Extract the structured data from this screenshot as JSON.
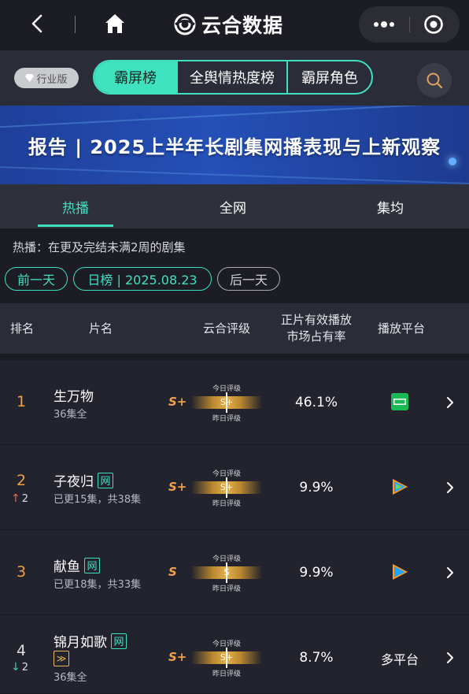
{
  "app": {
    "brand": "云合数据"
  },
  "category": {
    "edition_label": "行业版",
    "segments": [
      {
        "label": "霸屏榜",
        "active": true
      },
      {
        "label": "全舆情热度榜",
        "active": false
      },
      {
        "label": "霸屏角色",
        "active": false
      }
    ]
  },
  "banner": {
    "title": "报告 | 2025上半年长剧集网播表现与上新观察"
  },
  "tabs": [
    {
      "label": "热播",
      "active": true
    },
    {
      "label": "全网",
      "active": false
    },
    {
      "label": "集均",
      "active": false
    }
  ],
  "description": "热播：在更及完结未满2周的剧集",
  "date_nav": {
    "prev_label": "前一天",
    "current_label": "日榜 | 2025.08.23",
    "next_label": "后一天"
  },
  "table": {
    "headers": {
      "rank": "排名",
      "title": "片名",
      "rating": "云合评级",
      "share_line1": "正片有效播放",
      "share_line2": "市场占有率",
      "platform": "播放平台"
    },
    "gauge_labels": {
      "today": "今日评级",
      "yesterday": "昨日评级"
    },
    "rows": [
      {
        "rank": "1",
        "trend": "",
        "title": "生万物",
        "badge": "",
        "extra_badge": "",
        "episodes": "36集全",
        "grade": "S+",
        "today_grade": "S+",
        "share": "46.1%",
        "platform": "iqiyi",
        "platform_text": ""
      },
      {
        "rank": "2",
        "trend": "2",
        "trend_dir": "up",
        "title": "子夜归",
        "badge": "网",
        "extra_badge": "",
        "episodes": "已更15集，共38集",
        "grade": "S+",
        "today_grade": "S+",
        "share": "9.9%",
        "platform": "tencent",
        "platform_text": ""
      },
      {
        "rank": "3",
        "trend": "",
        "title": "献鱼",
        "badge": "网",
        "extra_badge": "",
        "episodes": "已更18集，共33集",
        "grade": "S",
        "today_grade": "S",
        "share": "9.9%",
        "platform": "tencent",
        "platform_text": ""
      },
      {
        "rank": "4",
        "trend": "2",
        "trend_dir": "down",
        "title": "锦月如歌",
        "badge": "网",
        "extra_badge": "≫",
        "episodes": "36集全",
        "grade": "S+",
        "today_grade": "S+",
        "share": "8.7%",
        "platform": "multi",
        "platform_text": "多平台"
      }
    ]
  },
  "colors": {
    "accent": "#3fe0bf",
    "rank": "#f0a14a",
    "background": "#1b1c24"
  }
}
